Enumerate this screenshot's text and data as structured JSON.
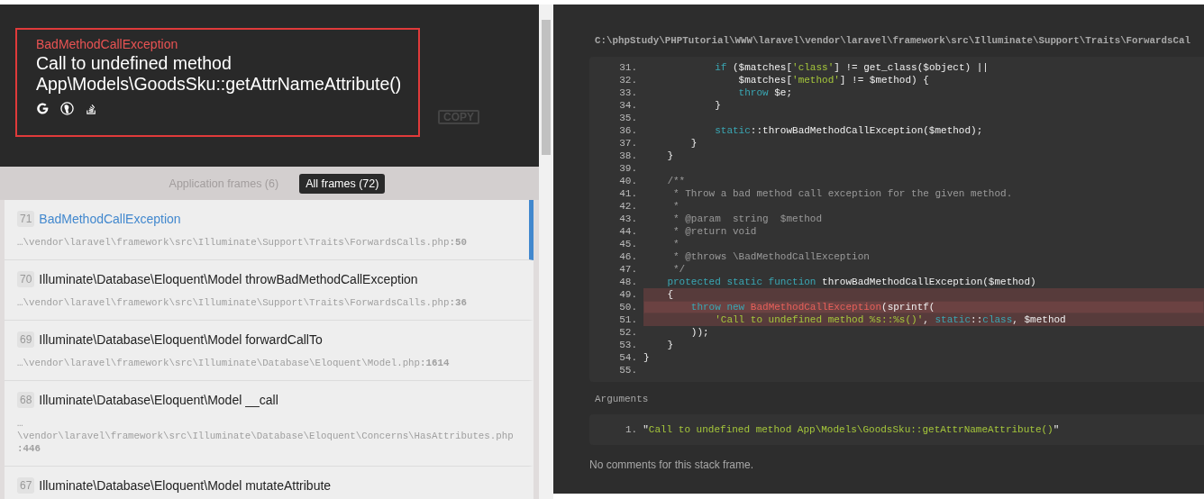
{
  "header": {
    "exception_type": "BadMethodCallException",
    "message": "Call to undefined method App\\Models\\GoodsSku::getAttrNameAttribute()",
    "copy_button": "COPY"
  },
  "frame_tabs": [
    {
      "label": "Application frames (6)",
      "selected": false
    },
    {
      "label": "All frames (72)",
      "selected": true
    }
  ],
  "frames": [
    {
      "number": "71",
      "title": "BadMethodCallException",
      "file": "…\\vendor\\laravel\\framework\\src\\Illuminate\\Support\\Traits\\ForwardsCalls.php**:50**",
      "selected": true
    },
    {
      "number": "70",
      "title": "Illuminate\\Database\\Eloquent\\Model throwBadMethodCallException",
      "file": "…\\vendor\\laravel\\framework\\src\\Illuminate\\Support\\Traits\\ForwardsCalls.php**:36**",
      "selected": false
    },
    {
      "number": "69",
      "title": "Illuminate\\Database\\Eloquent\\Model forwardCallTo",
      "file": "…\\vendor\\laravel\\framework\\src\\Illuminate\\Database\\Eloquent\\Model.php**:1614**",
      "selected": false
    },
    {
      "number": "68",
      "title": "Illuminate\\Database\\Eloquent\\Model __call",
      "file": "… \\vendor\\laravel\\framework\\src\\Illuminate\\Database\\Eloquent\\Concerns\\HasAttributes.php **:446**",
      "selected": false
    },
    {
      "number": "67",
      "title": "Illuminate\\Database\\Eloquent\\Model mutateAttribute",
      "selected": false
    }
  ],
  "code": {
    "file_path": "C:\\phpStudy\\PHPTutorial\\WWW\\laravel\\vendor\\laravel\\framework\\src\\Illuminate\\Support\\Traits\\ForwardsCal",
    "lines": [
      {
        "number": "31.",
        "highlighted": false,
        "current": false,
        "tokens": [
          {
            "kind": "keyword",
            "text": "            if"
          },
          {
            "kind": "plain",
            "text": " ($matches["
          },
          {
            "kind": "string",
            "text": "'class'"
          },
          {
            "kind": "plain",
            "text": "] != get_class($object) ||"
          }
        ]
      },
      {
        "number": "32.",
        "highlighted": false,
        "current": false,
        "tokens": [
          {
            "kind": "plain",
            "text": "                $matches["
          },
          {
            "kind": "string",
            "text": "'method'"
          },
          {
            "kind": "plain",
            "text": "] != $method) {"
          }
        ]
      },
      {
        "number": "33.",
        "highlighted": false,
        "current": false,
        "tokens": [
          {
            "kind": "keyword",
            "text": "                throw"
          },
          {
            "kind": "plain",
            "text": " $e;"
          }
        ]
      },
      {
        "number": "34.",
        "highlighted": false,
        "current": false,
        "tokens": [
          {
            "kind": "plain",
            "text": "            }"
          }
        ]
      },
      {
        "number": "35.",
        "highlighted": false,
        "current": false
      },
      {
        "number": "36.",
        "highlighted": false,
        "current": false,
        "tokens": [
          {
            "kind": "keyword",
            "text": "            static"
          },
          {
            "kind": "plain",
            "text": "::throwBadMethodCallException($method);"
          }
        ]
      },
      {
        "number": "37.",
        "highlighted": false,
        "current": false,
        "tokens": [
          {
            "kind": "plain",
            "text": "        }"
          }
        ]
      },
      {
        "number": "38.",
        "highlighted": false,
        "current": false,
        "tokens": [
          {
            "kind": "plain",
            "text": "    }"
          }
        ]
      },
      {
        "number": "39.",
        "highlighted": false,
        "current": false
      },
      {
        "number": "40.",
        "highlighted": false,
        "current": false,
        "tokens": [
          {
            "kind": "comment",
            "text": "    /**"
          }
        ]
      },
      {
        "number": "41.",
        "highlighted": false,
        "current": false,
        "tokens": [
          {
            "kind": "comment",
            "text": "     * Throw a bad method call exception for the given method."
          }
        ]
      },
      {
        "number": "42.",
        "highlighted": false,
        "current": false,
        "tokens": [
          {
            "kind": "comment",
            "text": "     *"
          }
        ]
      },
      {
        "number": "43.",
        "highlighted": false,
        "current": false,
        "tokens": [
          {
            "kind": "comment",
            "text": "     * @param  string  $method"
          }
        ]
      },
      {
        "number": "44.",
        "highlighted": false,
        "current": false,
        "tokens": [
          {
            "kind": "comment",
            "text": "     * @return void"
          }
        ]
      },
      {
        "number": "45.",
        "highlighted": false,
        "current": false,
        "tokens": [
          {
            "kind": "comment",
            "text": "     *"
          }
        ]
      },
      {
        "number": "46.",
        "highlighted": false,
        "current": false,
        "tokens": [
          {
            "kind": "comment",
            "text": "     * @throws \\BadMethodCallException"
          }
        ]
      },
      {
        "number": "47.",
        "highlighted": false,
        "current": false,
        "tokens": [
          {
            "kind": "comment",
            "text": "     */"
          }
        ]
      },
      {
        "number": "48.",
        "highlighted": false,
        "current": false,
        "tokens": [
          {
            "kind": "keyword",
            "text": "    protected static function"
          },
          {
            "kind": "plain",
            "text": " throwBadMethodCallException($method)"
          }
        ]
      },
      {
        "number": "49.",
        "highlighted": true,
        "current": false,
        "tokens": [
          {
            "kind": "plain",
            "text": "    {"
          }
        ]
      },
      {
        "number": "50.",
        "highlighted": true,
        "current": true,
        "tokens": [
          {
            "kind": "keyword",
            "text": "        throw new "
          },
          {
            "kind": "exception",
            "text": "BadMethodCallException"
          },
          {
            "kind": "plain",
            "text": "(sprintf("
          }
        ]
      },
      {
        "number": "51.",
        "highlighted": true,
        "current": false,
        "tokens": [
          {
            "kind": "string",
            "text": "            'Call to undefined method %s::%s()'"
          },
          {
            "kind": "plain",
            "text": ", "
          },
          {
            "kind": "keyword",
            "text": "static"
          },
          {
            "kind": "plain",
            "text": "::"
          },
          {
            "kind": "keyword",
            "text": "class"
          },
          {
            "kind": "plain",
            "text": ", $method"
          }
        ]
      },
      {
        "number": "52.",
        "highlighted": false,
        "current": false,
        "tokens": [
          {
            "kind": "plain",
            "text": "        ));"
          }
        ]
      },
      {
        "number": "53.",
        "highlighted": false,
        "current": false,
        "tokens": [
          {
            "kind": "plain",
            "text": "    }"
          }
        ]
      },
      {
        "number": "54.",
        "highlighted": false,
        "current": false,
        "tokens": [
          {
            "kind": "plain",
            "text": "}"
          }
        ]
      },
      {
        "number": "55.",
        "highlighted": false,
        "current": false
      }
    ]
  },
  "arguments": {
    "title": "Arguments",
    "items": [
      {
        "number": "1.",
        "tokens": [
          {
            "kind": "plain",
            "text": "\""
          },
          {
            "kind": "string",
            "text": "Call to undefined method App\\Models\\GoodsSku::getAttrNameAttribute()"
          },
          {
            "kind": "plain",
            "text": "\""
          }
        ]
      }
    ]
  },
  "comments": "No comments for this stack frame."
}
